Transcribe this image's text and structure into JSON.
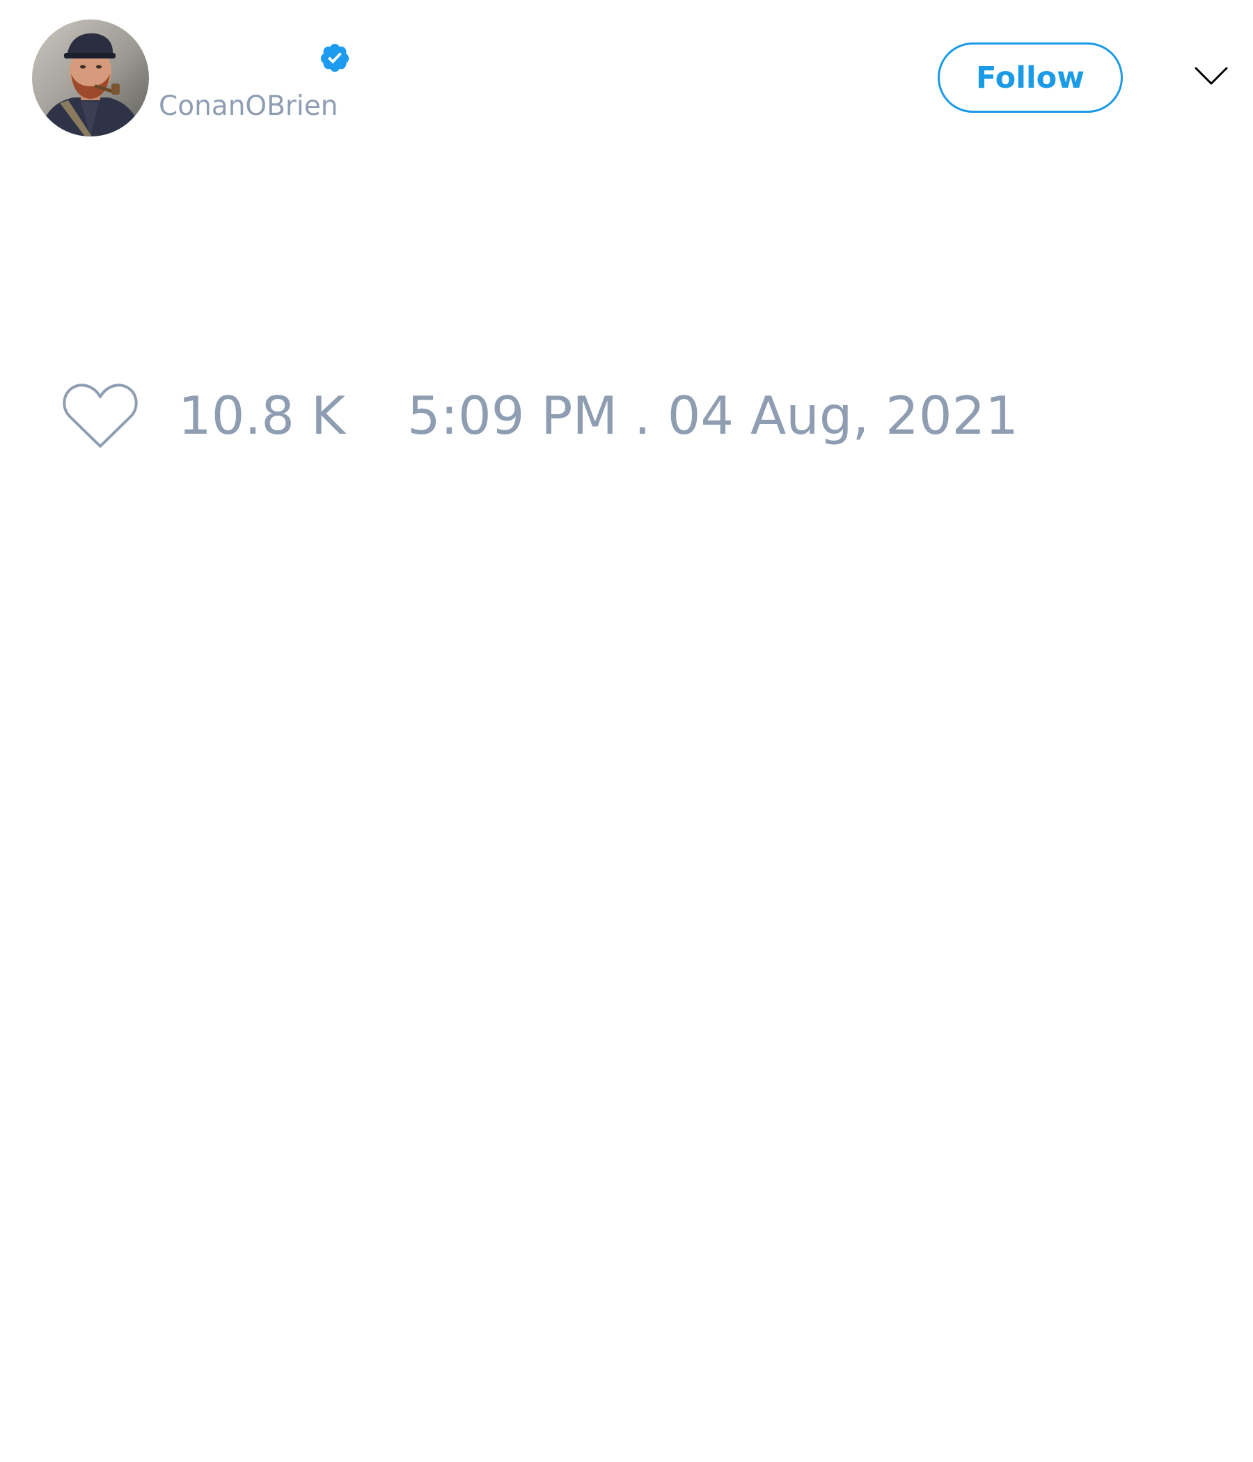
{
  "author": {
    "handle": "ConanOBrien",
    "verified": true,
    "avatar_icon": "profile-photo"
  },
  "header": {
    "follow_label": "Follow",
    "menu_icon": "chevron-down-icon"
  },
  "stats": {
    "like_icon": "heart-icon",
    "likes": "10.8 K",
    "timestamp": "5:09 PM . 04 Aug, 2021"
  },
  "colors": {
    "accent": "#1b9ae6",
    "muted_text": "#8e9db2",
    "background": "#ffffff"
  }
}
